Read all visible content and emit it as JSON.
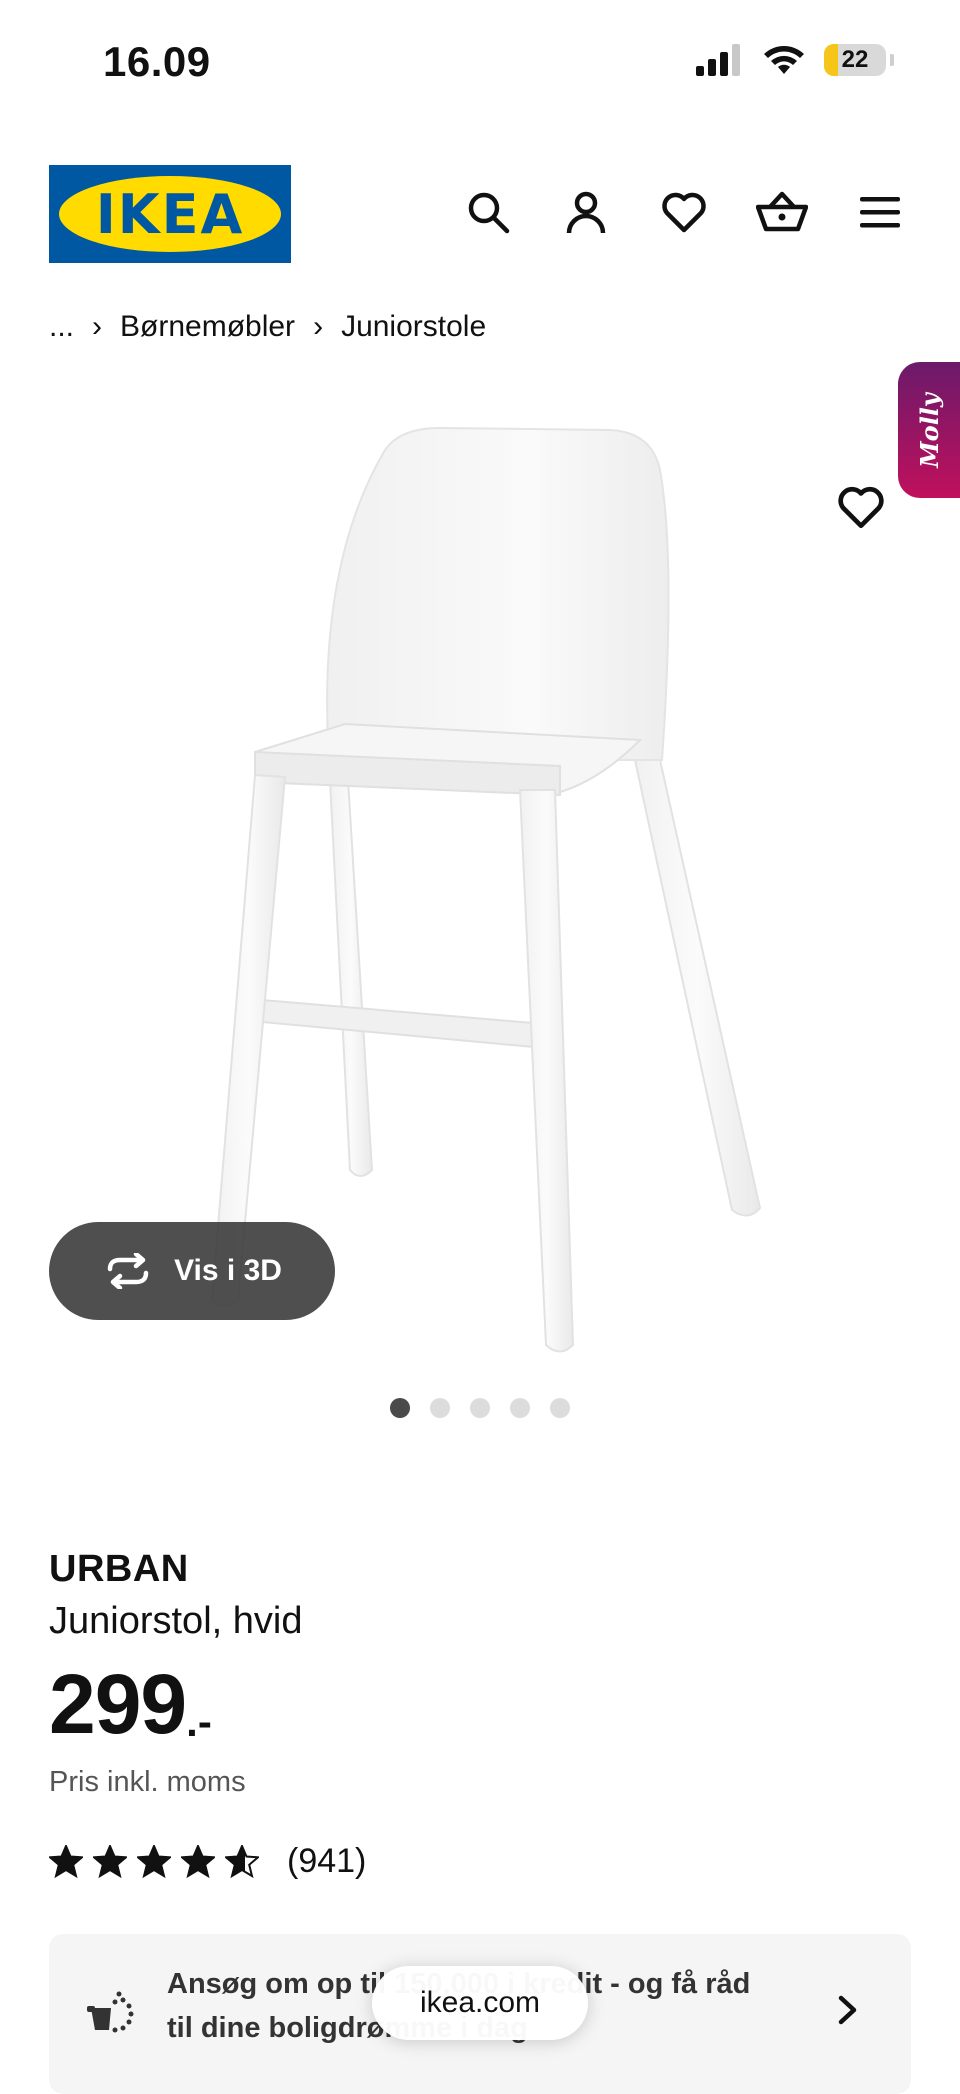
{
  "status_bar": {
    "time": "16.09",
    "battery": "22",
    "battery_level": 0.22
  },
  "header": {
    "logo_text": "IKEA",
    "icons": [
      "search-icon",
      "account-icon",
      "favorites-icon",
      "basket-icon",
      "menu-icon"
    ]
  },
  "breadcrumb": {
    "items": [
      "...",
      "Børnemøbler",
      "Juniorstole"
    ]
  },
  "gallery": {
    "chat_badge": "Molly",
    "view_3d_label": "Vis i 3D",
    "dot_count": 5,
    "active_dot": 0
  },
  "product": {
    "name": "URBAN",
    "description": "Juniorstol, hvid",
    "price": "299",
    "price_suffix": ".-",
    "price_note": "Pris inkl. moms",
    "rating_stars": 5,
    "rating_value": 4.6,
    "rating_count": "(941)"
  },
  "credit_banner": {
    "text": "Ansøg om op til 150.000 i kredit - og få råd til dine boligdrømme i dag"
  },
  "browser": {
    "url": "ikea.com"
  },
  "colors": {
    "ikea_blue": "#0058a3",
    "ikea_yellow": "#ffdb00",
    "chat_gradient_start": "#6b1a6a",
    "chat_gradient_end": "#c0105c"
  }
}
